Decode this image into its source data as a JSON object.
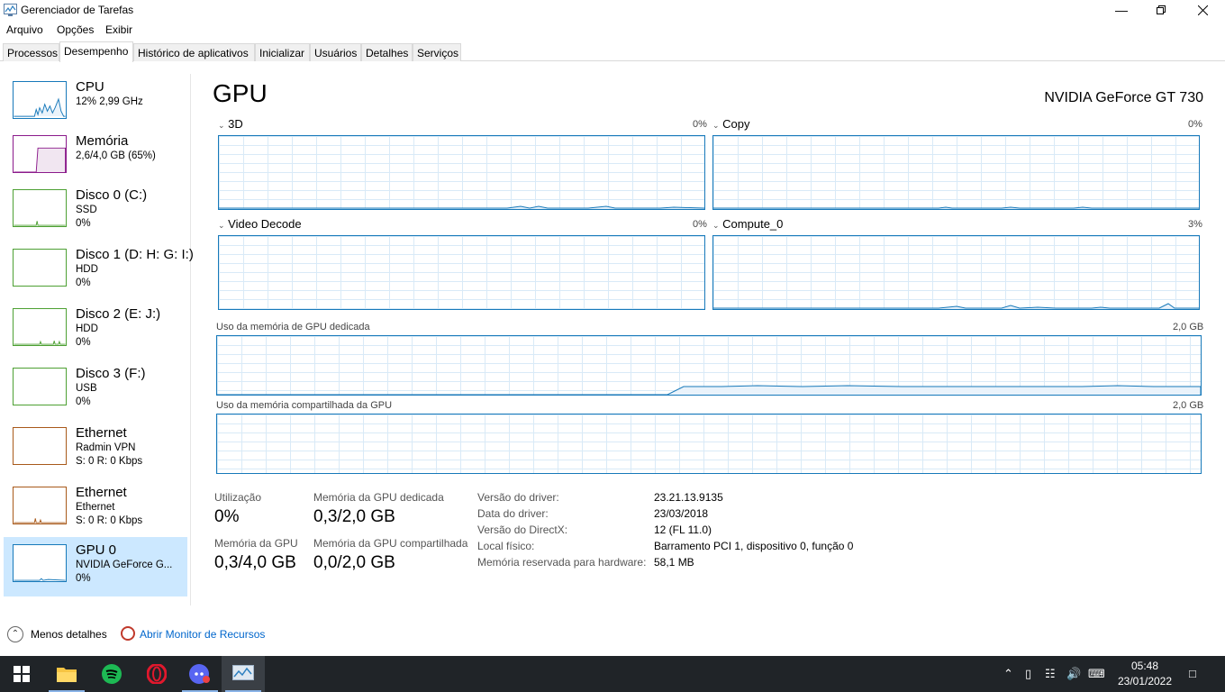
{
  "window": {
    "title": "Gerenciador de Tarefas"
  },
  "menu": [
    "Arquivo",
    "Opções",
    "Exibir"
  ],
  "tabs": [
    "Processos",
    "Desempenho",
    "Histórico de aplicativos",
    "Inicializar",
    "Usuários",
    "Detalhes",
    "Serviços"
  ],
  "sidebar": [
    {
      "title": "CPU",
      "lines": [
        "12% 2,99 GHz"
      ]
    },
    {
      "title": "Memória",
      "lines": [
        "2,6/4,0 GB (65%)"
      ]
    },
    {
      "title": "Disco 0 (C:)",
      "lines": [
        "SSD",
        "0%"
      ]
    },
    {
      "title": "Disco 1 (D: H: G: I:)",
      "lines": [
        "HDD",
        "0%"
      ]
    },
    {
      "title": "Disco 2 (E: J:)",
      "lines": [
        "HDD",
        "0%"
      ]
    },
    {
      "title": "Disco 3 (F:)",
      "lines": [
        "USB",
        "0%"
      ]
    },
    {
      "title": "Ethernet",
      "lines": [
        "Radmin VPN",
        "S: 0 R: 0 Kbps"
      ]
    },
    {
      "title": "Ethernet",
      "lines": [
        "Ethernet",
        "S: 0 R: 0 Kbps"
      ]
    },
    {
      "title": "GPU 0",
      "lines": [
        "NVIDIA GeForce G...",
        "0%"
      ]
    }
  ],
  "main": {
    "title": "GPU",
    "model": "NVIDIA GeForce GT 730",
    "engines": [
      {
        "label": "3D",
        "pct": "0%"
      },
      {
        "label": "Copy",
        "pct": "0%"
      },
      {
        "label": "Video Decode",
        "pct": "0%"
      },
      {
        "label": "Compute_0",
        "pct": "3%"
      }
    ],
    "dedicated_label": "Uso da memória de GPU dedicada",
    "dedicated_max": "2,0 GB",
    "shared_label": "Uso da memória compartilhada da GPU",
    "shared_max": "2,0 GB",
    "stats": {
      "util_label": "Utilização",
      "util_value": "0%",
      "dedicated_label": "Memória da GPU dedicada",
      "dedicated_value": "0,3/2,0 GB",
      "gpu_mem_label": "Memória da GPU",
      "gpu_mem_value": "0,3/4,0 GB",
      "shared_label": "Memória da GPU compartilhada",
      "shared_value": "0,0/2,0 GB"
    },
    "info": [
      {
        "label": "Versão do driver:",
        "value": "23.21.13.9135"
      },
      {
        "label": "Data do driver:",
        "value": "23/03/2018"
      },
      {
        "label": "Versão do DirectX:",
        "value": "12 (FL 11.0)"
      },
      {
        "label": "Local físico:",
        "value": "Barramento PCI 1, dispositivo 0, função 0"
      },
      {
        "label": "Memória reservada para hardware:",
        "value": "58,1 MB"
      }
    ]
  },
  "footer": {
    "less_details": "Menos detalhes",
    "resource_monitor": "Abrir Monitor de Recursos"
  },
  "taskbar": {
    "time": "05:48",
    "date": "23/01/2022"
  }
}
